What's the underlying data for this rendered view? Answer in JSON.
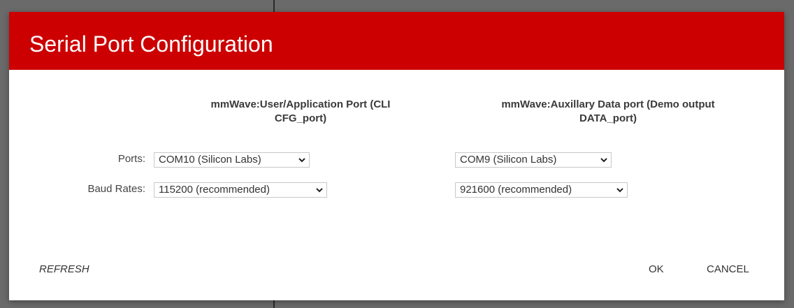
{
  "dialog": {
    "title": "Serial Port Configuration",
    "header_color": "#cc0000"
  },
  "columns": {
    "cli": {
      "header_line1": "mmWave:User/Application Port (CLI",
      "header_line2": "CFG_port)",
      "port_value": "COM10 (Silicon Labs)",
      "baud_value": "115200 (recommended)"
    },
    "data": {
      "header_line1": "mmWave:Auxillary Data port (Demo output",
      "header_line2": "DATA_port)",
      "port_value": "COM9 (Silicon Labs)",
      "baud_value": "921600 (recommended)"
    }
  },
  "rows": {
    "ports_label": "Ports:",
    "baud_label": "Baud Rates:"
  },
  "actions": {
    "refresh": "REFRESH",
    "ok": "OK",
    "cancel": "CANCEL"
  },
  "icons": {
    "dropdown": "chevron-down-icon"
  }
}
